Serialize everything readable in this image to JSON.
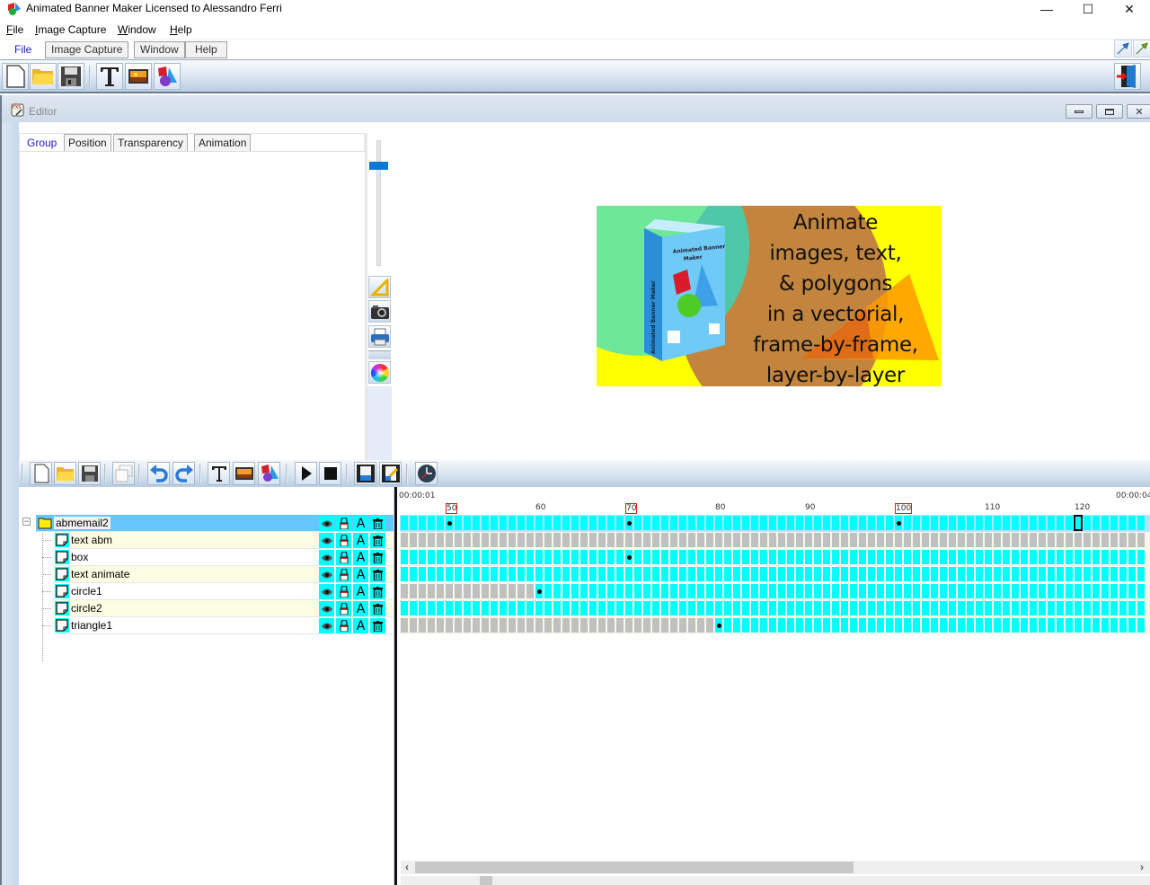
{
  "window": {
    "title": "Animated Banner Maker Licensed to Alessandro Ferri",
    "controls": {
      "minimize": "—",
      "maximize": "☐",
      "close": "✕"
    }
  },
  "menubar": [
    {
      "label": "File",
      "mnemonic": "F"
    },
    {
      "label": "Image Capture",
      "mnemonic": "I"
    },
    {
      "label": "Window",
      "mnemonic": "W"
    },
    {
      "label": "Help",
      "mnemonic": "H"
    }
  ],
  "ribbon_tabs": [
    {
      "label": "File",
      "active": true
    },
    {
      "label": "Image Capture",
      "active": false
    },
    {
      "label": "Window",
      "active": false
    },
    {
      "label": "Help",
      "active": false
    }
  ],
  "toolbar": {
    "buttons": [
      "new-file",
      "open-folder",
      "save",
      "add-text",
      "add-image",
      "add-shapes"
    ],
    "right_button": "exit-door"
  },
  "editor": {
    "title": "Editor",
    "property_tabs": [
      {
        "label": "Group",
        "active": true
      },
      {
        "label": "Position",
        "active": false
      },
      {
        "label": "Transparency",
        "active": false
      },
      {
        "label": "Animation",
        "active": false
      }
    ],
    "side_tools": [
      "ruler-triangle",
      "camera",
      "printer",
      "color-wheel"
    ]
  },
  "banner": {
    "lines": [
      "Animate",
      "images, text,",
      "& polygons",
      "in a vectorial,",
      "frame-by-frame,",
      "layer-by-layer"
    ],
    "box_title": "Animated Banner Maker",
    "colors": {
      "background": "#ffff00",
      "circle1": "#5ee5a8",
      "circle2": "#c07e40",
      "triangle": "#ff9900"
    }
  },
  "timeline_toolbar": [
    "new",
    "open",
    "save",
    "copy",
    "undo",
    "redo",
    "text",
    "image",
    "shapes",
    "play",
    "stop",
    "export-film",
    "film-settings",
    "clock"
  ],
  "layers": [
    {
      "name": "abmemail2",
      "type": "group",
      "selected": true
    },
    {
      "name": "text abm",
      "type": "layer"
    },
    {
      "name": "box",
      "type": "layer"
    },
    {
      "name": "text animate",
      "type": "layer"
    },
    {
      "name": "circle1",
      "type": "layer"
    },
    {
      "name": "circle2",
      "type": "layer"
    },
    {
      "name": "triangle1",
      "type": "layer"
    }
  ],
  "layer_actions": [
    "visibility-eye",
    "lock",
    "text-style",
    "delete"
  ],
  "timeline": {
    "start_time": "00:00:01",
    "end_time": "00:00:04",
    "first_visible_frame": 45,
    "last_visible_frame": 127,
    "current_frame": 120,
    "ruler_labels": [
      {
        "frame": 50,
        "label": "50",
        "marked": true
      },
      {
        "frame": 60,
        "label": "60",
        "marked": false
      },
      {
        "frame": 70,
        "label": "70",
        "marked": true
      },
      {
        "frame": 80,
        "label": "80",
        "marked": false
      },
      {
        "frame": 90,
        "label": "90",
        "marked": false
      },
      {
        "frame": 100,
        "label": "100",
        "marked": true
      },
      {
        "frame": 110,
        "label": "110",
        "marked": false
      },
      {
        "frame": 120,
        "label": "120",
        "marked": false
      }
    ],
    "tracks": [
      {
        "layer": "abmemail2",
        "active_from": 45,
        "keyframes": [
          50,
          70,
          100
        ]
      },
      {
        "layer": "text abm",
        "active_from": null,
        "keyframes": []
      },
      {
        "layer": "box",
        "active_from": 45,
        "keyframes": [
          70
        ]
      },
      {
        "layer": "text animate",
        "active_from": 45,
        "keyframes": []
      },
      {
        "layer": "circle1",
        "active_from": 60,
        "keyframes": [
          60
        ]
      },
      {
        "layer": "circle2",
        "active_from": 45,
        "keyframes": []
      },
      {
        "layer": "triangle1",
        "active_from": 80,
        "keyframes": [
          80
        ]
      }
    ],
    "scroll_position": 0.02
  }
}
